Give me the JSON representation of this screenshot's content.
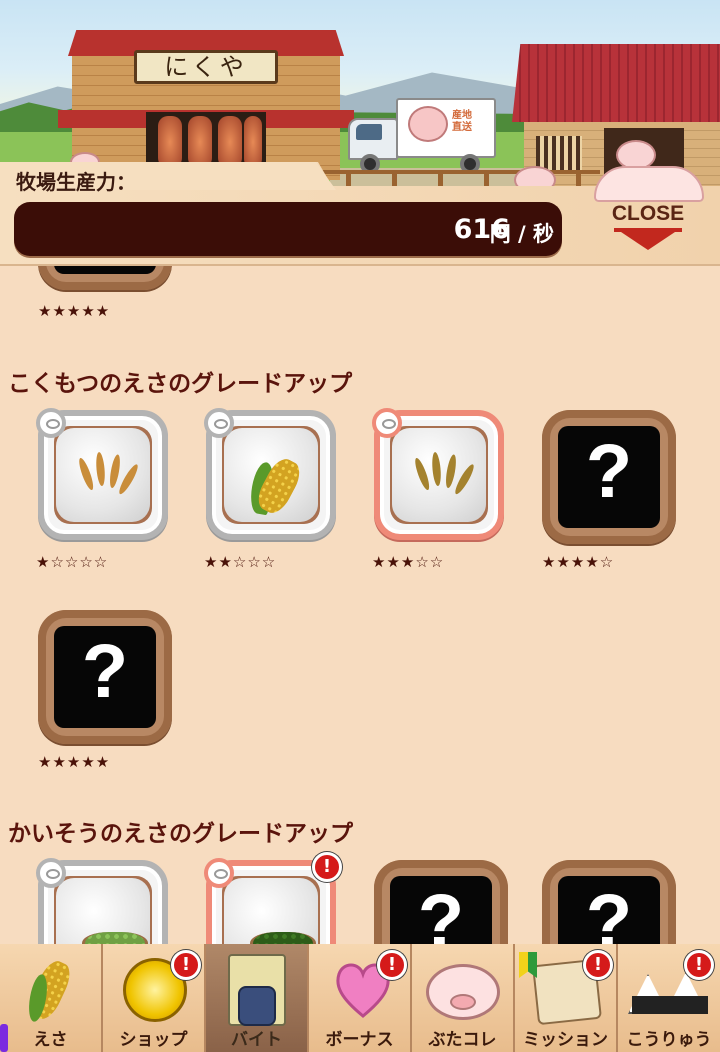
{
  "scene": {
    "shop_sign": "にくや",
    "truck_text": "産地直送"
  },
  "header": {
    "production_label": "牧場生産力：",
    "production_value": "616",
    "production_unit": "円 / 秒",
    "close_label": "CLOSE"
  },
  "top_partial": {
    "stars": "★★★★★"
  },
  "sections": [
    {
      "title": "こくもつのえさのグレードアップ",
      "items": [
        {
          "state": "owned",
          "frame": "gray",
          "icon": "wheat-sack-icon",
          "stars": "★☆☆☆☆"
        },
        {
          "state": "owned",
          "frame": "gray",
          "icon": "corn-sack-icon",
          "stars": "★★☆☆☆"
        },
        {
          "state": "owned",
          "frame": "red",
          "icon": "wheat-sack-icon",
          "stars": "★★★☆☆"
        },
        {
          "state": "locked",
          "symbol": "?",
          "stars": "★★★★☆"
        },
        {
          "state": "locked",
          "symbol": "?",
          "stars": "★★★★★"
        }
      ]
    },
    {
      "title": "かいそうのえさのグレードアップ",
      "items": [
        {
          "state": "owned",
          "frame": "gray",
          "icon": "seaweed-sack-icon"
        },
        {
          "state": "owned",
          "frame": "red",
          "icon": "seaweed-sack-icon",
          "badge": "!"
        },
        {
          "state": "locked",
          "symbol": "?"
        },
        {
          "state": "locked",
          "symbol": "?"
        }
      ]
    }
  ],
  "nav": [
    {
      "label": "えさ",
      "icon": "corn-icon",
      "active": false,
      "badge": ""
    },
    {
      "label": "ショップ",
      "icon": "coin-icon",
      "active": false,
      "badge": "!"
    },
    {
      "label": "バイト",
      "icon": "locked-card-icon",
      "active": true,
      "badge": ""
    },
    {
      "label": "ボーナス",
      "icon": "heart-icon",
      "active": false,
      "badge": "!"
    },
    {
      "label": "ぶたコレ",
      "icon": "pig-face-icon",
      "active": false,
      "badge": ""
    },
    {
      "label": "ミッション",
      "icon": "scroll-icon",
      "active": false,
      "badge": "!"
    },
    {
      "label": "こうりゅう",
      "icon": "rice-ball-icon",
      "active": false,
      "badge": "!"
    }
  ],
  "colors": {
    "accent_dark": "#3b0d07",
    "close_arrow": "#c2281e",
    "badge": "#d51a1a",
    "section_title": "#5a140c"
  }
}
